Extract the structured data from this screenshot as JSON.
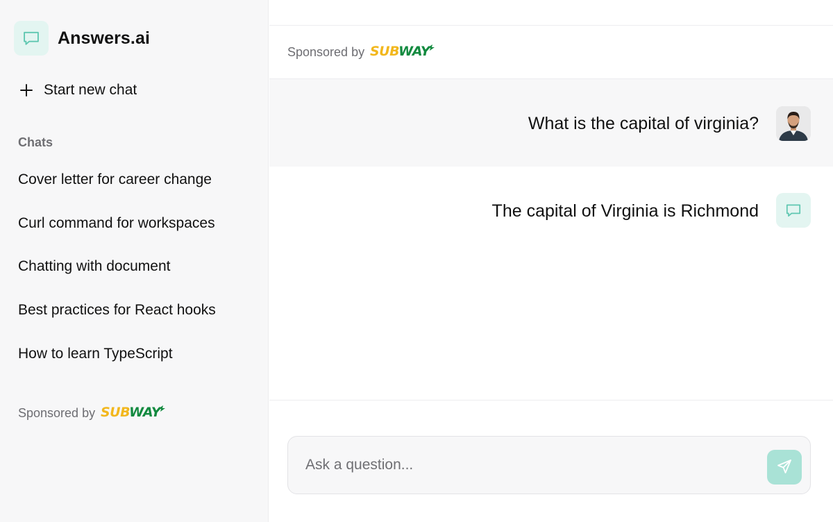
{
  "app": {
    "name": "Answers.ai",
    "accent_color": "#5fc7b1",
    "logo_icon": "chat-bubble-icon"
  },
  "sidebar": {
    "new_chat_label": "Start new chat",
    "chats_heading": "Chats",
    "chats": [
      "Cover letter for career change",
      "Curl command for workspaces",
      "Chatting with document",
      "Best practices for React hooks",
      "How to learn TypeScript"
    ],
    "sponsor_text": "Sponsored by",
    "sponsor_brand": "SUBWAY"
  },
  "main": {
    "sponsor_text": "Sponsored by",
    "sponsor_brand": "SUBWAY",
    "messages": [
      {
        "role": "user",
        "text": "What is the capital of virginia?"
      },
      {
        "role": "assistant",
        "text": "The capital of Virginia is Richmond"
      }
    ],
    "input_placeholder": "Ask a question...",
    "send_icon": "send-icon"
  },
  "colors": {
    "subway_yellow": "#f2b71d",
    "subway_green": "#128a3f",
    "sidebar_bg": "#f7f7f8",
    "icon_bg": "#e3f5f1",
    "send_bg": "#a9e2d6"
  }
}
